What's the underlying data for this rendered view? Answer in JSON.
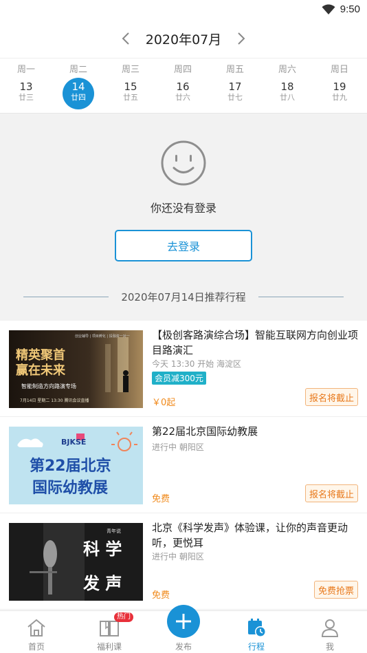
{
  "status_bar": {
    "time": "9:50",
    "wifi_icon": "wifi-icon"
  },
  "calendar": {
    "month_title": "2020年07月",
    "days": [
      {
        "dow": "周一",
        "num": "13",
        "lunar": "廿三",
        "selected": false
      },
      {
        "dow": "周二",
        "num": "14",
        "lunar": "廿四",
        "selected": true
      },
      {
        "dow": "周三",
        "num": "15",
        "lunar": "廿五",
        "selected": false
      },
      {
        "dow": "周四",
        "num": "16",
        "lunar": "廿六",
        "selected": false
      },
      {
        "dow": "周五",
        "num": "17",
        "lunar": "廿七",
        "selected": false
      },
      {
        "dow": "周六",
        "num": "18",
        "lunar": "廿八",
        "selected": false
      },
      {
        "dow": "周日",
        "num": "19",
        "lunar": "廿九",
        "selected": false
      }
    ]
  },
  "login": {
    "message": "你还没有登录",
    "button_label": "去登录"
  },
  "recommend": {
    "title": "2020年07月14日推荐行程"
  },
  "events": [
    {
      "title": "【极创客路演综合场】智能互联网方向创业项目路演汇",
      "meta": "今天 13:30 开始  海淀区",
      "badge": "会员减300元",
      "price": "￥0起",
      "action": "报名将截止",
      "thumb": {
        "heading1": "精英聚首",
        "heading2": "赢在未来",
        "sub": "智能制造方向路演专场",
        "top_caption": "创业辅导 | 项目孵化 | 投融资一对一",
        "bottom_caption": "7月14日 星期二 13:30    腾讯会议直播"
      }
    },
    {
      "title": "第22届北京国际幼教展",
      "meta": "进行中  朝阳区",
      "price": "免费",
      "action": "报名将截止",
      "thumb": {
        "logo": "BJKSE",
        "line1": "第22届北京",
        "line2": "国际幼教展"
      }
    },
    {
      "title": "北京《科学发声》体验课，让你的声音更动听，更悦耳",
      "meta": "进行中  朝阳区",
      "price": "免费",
      "action": "免费抢票",
      "thumb": {
        "brand": "青年说",
        "char1": "科 学",
        "char2": "发 声"
      }
    }
  ],
  "nav": {
    "items": [
      {
        "label": "首页",
        "icon": "home-icon",
        "active": false
      },
      {
        "label": "福利课",
        "icon": "book-icon",
        "active": false,
        "badge": "热门"
      },
      {
        "label": "发布",
        "icon": "plus-icon",
        "active": false
      },
      {
        "label": "行程",
        "icon": "calendar-clock-icon",
        "active": true
      },
      {
        "label": "我",
        "icon": "user-icon",
        "active": false
      }
    ]
  },
  "colors": {
    "primary": "#1a92d6",
    "accent_orange": "#f08a1c",
    "hot_red": "#e8303a",
    "teal_badge": "#20b0c8"
  }
}
